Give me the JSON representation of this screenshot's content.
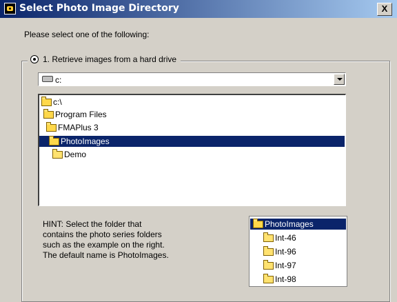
{
  "window": {
    "title": "Select Photo Image Directory",
    "close_label": "X"
  },
  "prompt": "Please select one of the following:",
  "options": {
    "retrieve_hard_drive": "1. Retrieve images from a hard drive"
  },
  "drive_combo": {
    "value": "c:"
  },
  "folder_tree": {
    "items": [
      {
        "label": "c:\\",
        "selected": false
      },
      {
        "label": "Program Files",
        "selected": false
      },
      {
        "label": "FMAPlus 3",
        "selected": false
      },
      {
        "label": "PhotoImages",
        "selected": true
      },
      {
        "label": "Demo",
        "selected": false
      }
    ]
  },
  "hint": {
    "line1": "HINT: Select the folder that",
    "line2": "contains the photo series folders",
    "line3": "such as the example on the right.",
    "line4": "The default name is PhotoImages."
  },
  "example_tree": {
    "items": [
      {
        "label": "PhotoImages",
        "selected": true
      },
      {
        "label": "Int-46",
        "selected": false
      },
      {
        "label": "Int-96",
        "selected": false
      },
      {
        "label": "Int-97",
        "selected": false
      },
      {
        "label": "Int-98",
        "selected": false
      }
    ]
  }
}
